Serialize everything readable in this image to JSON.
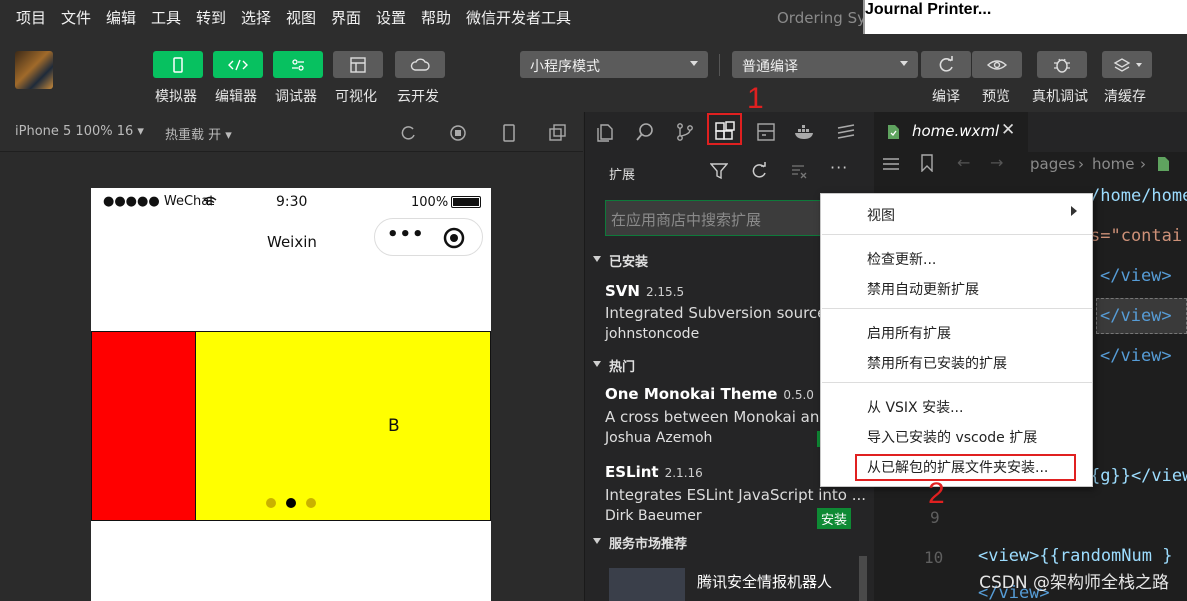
{
  "menubar": {
    "items": [
      "项目",
      "文件",
      "编辑",
      "工具",
      "转到",
      "选择",
      "视图",
      "界面",
      "设置",
      "帮助",
      "微信开发者工具"
    ],
    "window_title": "Ordering Sy",
    "popup_title": "Journal Printer..."
  },
  "toolbar": {
    "left_buttons": [
      {
        "label": "模拟器",
        "icon": "phone-icon",
        "color": "#07c160"
      },
      {
        "label": "编辑器",
        "icon": "code-icon",
        "color": "#07c160"
      },
      {
        "label": "调试器",
        "icon": "sliders-icon",
        "color": "#07c160"
      },
      {
        "label": "可视化",
        "icon": "layout-icon",
        "color": "#5b5b5b"
      },
      {
        "label": "云开发",
        "icon": "cloud-icon",
        "color": "#5b5b5b"
      }
    ],
    "mode_select": "小程序模式",
    "compile_select": "普通编译",
    "right_buttons": [
      {
        "label": "编译",
        "icon": "refresh-icon"
      },
      {
        "label": "预览",
        "icon": "eye-icon"
      },
      {
        "label": "真机调试",
        "icon": "bug-icon"
      },
      {
        "label": "清缓存",
        "icon": "layers-icon"
      }
    ]
  },
  "simulator": {
    "device_select": "iPhone 5 100% 16",
    "hot_reload": "热重载 开",
    "status_carrier": "●●●●● WeChat",
    "status_time": "9:30",
    "status_battery": "100%",
    "nav_title": "Weixin",
    "swiper_label": "B",
    "swiper_dots": {
      "count": 3,
      "active_index": 1
    }
  },
  "extensions": {
    "title": "扩展",
    "search_placeholder": "在应用商店中搜索扩展",
    "sections": {
      "installed": "已安装",
      "popular": "热门",
      "market": "服务市场推荐"
    },
    "installed_items": [
      {
        "name": "SVN",
        "version": "2.15.5",
        "description": "Integrated Subversion source c",
        "author": "johnstoncode"
      }
    ],
    "popular_items": [
      {
        "name": "One Monokai Theme",
        "version": "0.5.0",
        "description": "A cross between Monokai and",
        "author": "Joshua Azemoh"
      },
      {
        "name": "ESLint",
        "version": "2.1.16",
        "description": "Integrates ESLint JavaScript into ...",
        "author": "Dirk Baeumer",
        "install_label": "安装"
      }
    ],
    "market_items": [
      {
        "name": "腾讯安全情报机器人"
      }
    ]
  },
  "editor": {
    "tab_name": "home.wxml",
    "breadcrumb": [
      "pages",
      "home"
    ],
    "code_lines": [
      {
        "text": "/home/home",
        "color": "#9cdcfe"
      },
      {
        "text": "s=\"contai",
        "color": "#ce9178"
      },
      {
        "text": "</view>",
        "color": "#569cd6"
      },
      {
        "text": "</view>",
        "color": "#569cd6"
      },
      {
        "text": "</view>",
        "color": "#569cd6"
      },
      {
        "text": "{g}}</view",
        "color": "#9cdcfe"
      },
      {
        "text": "<view>{{randomNum }",
        "color": "#9cdcfe"
      },
      {
        "text": "</view>",
        "color": "#569cd6"
      }
    ],
    "line_numbers": [
      "9",
      "10"
    ]
  },
  "context_menu": {
    "items": [
      {
        "label": "视图",
        "submenu": true
      },
      {
        "label": "检查更新..."
      },
      {
        "label": "禁用自动更新扩展"
      },
      {
        "label": "启用所有扩展"
      },
      {
        "label": "禁用所有已安装的扩展"
      },
      {
        "label": "从 VSIX 安装..."
      },
      {
        "label": "导入已安装的 vscode 扩展"
      },
      {
        "label": "从已解包的扩展文件夹安装..."
      }
    ]
  },
  "annotations": {
    "step1": "1",
    "step2": "2",
    "highlight_color": "#e02020"
  },
  "watermark": "CSDN @架构师全栈之路"
}
